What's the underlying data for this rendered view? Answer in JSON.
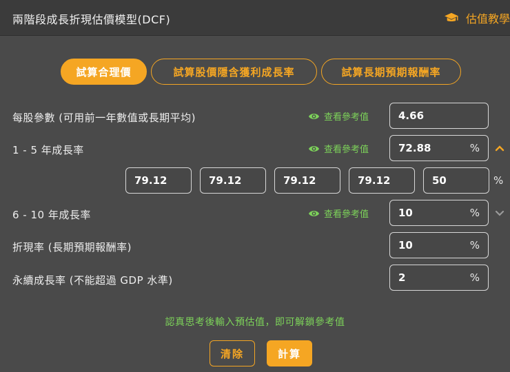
{
  "header": {
    "title": "兩階段成長折現估價模型(DCF)",
    "tutorial_label": "估值教學"
  },
  "tabs": [
    {
      "label": "試算合理價",
      "active": true
    },
    {
      "label": "試算股價隱含獲利成長率",
      "active": false
    },
    {
      "label": "試算長期預期報酬率",
      "active": false
    }
  ],
  "ref_label": "查看參考值",
  "rows": {
    "eps": {
      "label": "每股參數 (可用前一年數值或長期平均)",
      "value": "4.66"
    },
    "growth_1_5": {
      "label": "1 - 5 年成長率",
      "value": "72.88",
      "unit": "%",
      "expanded": true
    },
    "yearly": {
      "values": [
        "79.12",
        "79.12",
        "79.12",
        "79.12",
        "50"
      ],
      "unit": "%"
    },
    "growth_6_10": {
      "label": "6 - 10 年成長率",
      "value": "10",
      "unit": "%",
      "expanded": false
    },
    "discount": {
      "label": "折現率 (長期預期報酬率)",
      "value": "10",
      "unit": "%"
    },
    "perpetual": {
      "label": "永續成長率 (不能超過 GDP 水準)",
      "value": "2",
      "unit": "%"
    }
  },
  "hint": "認真思考後輸入預估值，即可解鎖參考值",
  "buttons": {
    "clear": "清除",
    "calculate": "計算"
  },
  "colors": {
    "accent": "#f5a623",
    "green": "#7dd35a",
    "background": "#4a4a4a",
    "header": "#3b3b3b"
  }
}
